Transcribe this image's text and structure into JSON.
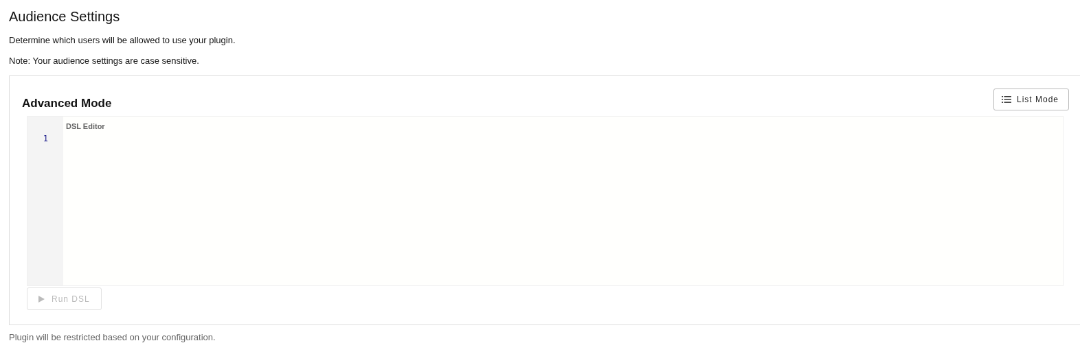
{
  "page": {
    "title": "Audience Settings",
    "description": "Determine which users will be allowed to use your plugin.",
    "note": "Note: Your audience settings are case sensitive."
  },
  "panel": {
    "title": "Advanced Mode",
    "mode_button": {
      "label": "List Mode"
    },
    "editor": {
      "label": "DSL Editor",
      "line_numbers": [
        "1"
      ]
    },
    "run_button": {
      "label": "Run DSL",
      "disabled": true
    }
  },
  "footer": "Plugin will be restricted based on your configuration."
}
